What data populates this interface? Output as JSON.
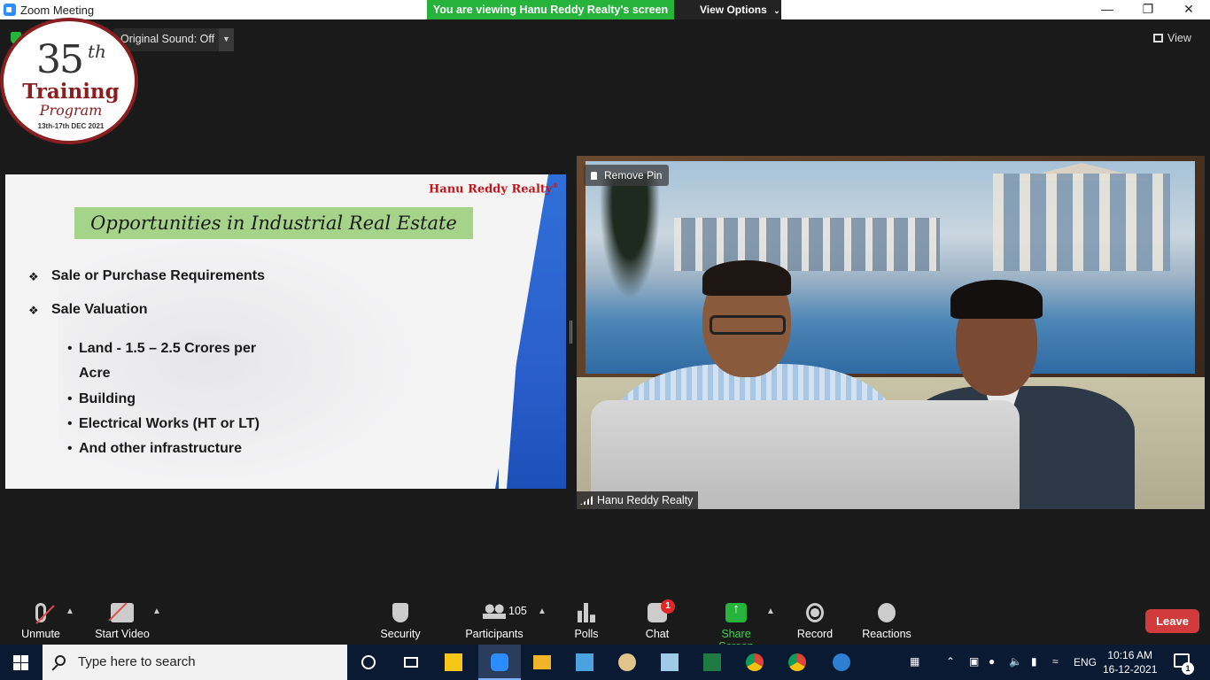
{
  "window": {
    "title": "Zoom Meeting",
    "viewing_banner": "You are viewing Hanu Reddy Realty's screen",
    "view_options": "View Options",
    "minimize": "—",
    "restore": "❐",
    "close": "✕"
  },
  "top_bar": {
    "audio_status": "Original Sound: Off",
    "view_label": "View"
  },
  "badge": {
    "number": "35",
    "suffix": "th",
    "line1": "Training",
    "line2": "Program",
    "dates": "13th-17th DEC 2021"
  },
  "slide": {
    "brand": "Hanu Reddy Realty",
    "brand_mark": "®",
    "heading": "Opportunities in Industrial Real Estate",
    "bullets": [
      "Sale or Purchase Requirements",
      "Sale Valuation"
    ],
    "sub_bullets": [
      "Land - 1.5 – 2.5 Crores per",
      "Acre",
      "Building",
      "Electrical Works (HT or LT)",
      "And other infrastructure"
    ]
  },
  "video": {
    "remove_pin": "Remove Pin",
    "participant_name": "Hanu Reddy Realty"
  },
  "toolbar": {
    "unmute": "Unmute",
    "start_video": "Start Video",
    "security": "Security",
    "participants": "Participants",
    "participant_count": "105",
    "polls": "Polls",
    "chat": "Chat",
    "chat_badge": "1",
    "share_screen": "Share Screen",
    "record": "Record",
    "reactions": "Reactions",
    "leave": "Leave"
  },
  "taskbar": {
    "search_placeholder": "Type here to search",
    "language": "ENG",
    "time": "10:16 AM",
    "date": "16-12-2021",
    "notification_count": "1"
  },
  "colors": {
    "zoom_green": "#25b33b",
    "leave_red": "#d13b3b",
    "slide_heading_bg": "#a6d38a",
    "brand_red": "#c0161d",
    "taskbar_bg": "#0a1a33"
  }
}
